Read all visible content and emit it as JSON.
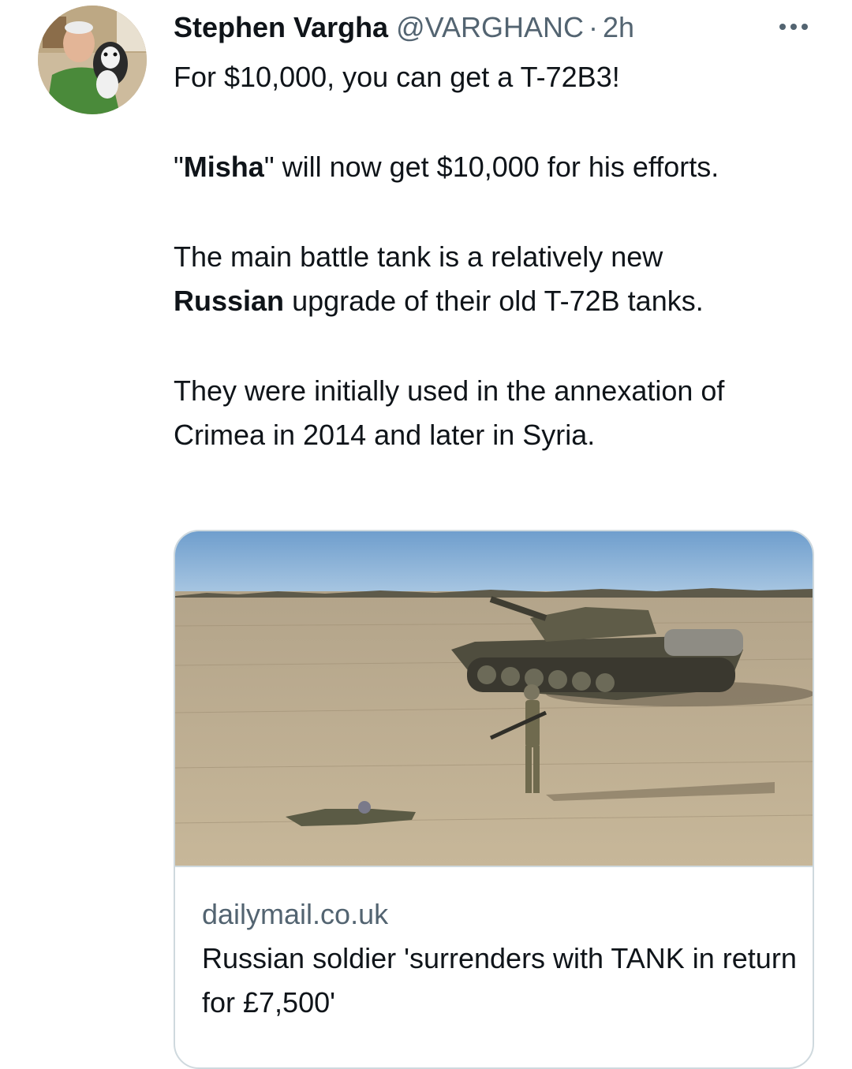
{
  "tweet": {
    "author_name": "Stephen Vargha",
    "author_handle": "@VARGHANC",
    "separator": "·",
    "time": "2h",
    "more_icon": "more-horizontal-icon",
    "avatar_icon": "profile-avatar",
    "text": {
      "line1": "For $10,000, you can get a T-72B3!",
      "p2_quote_open": "\"",
      "p2_bold": "Misha",
      "p2_rest": "\" will now get $10,000 for his efforts.",
      "p3_bold": "Russian",
      "p3_prefix": "The main battle tank is a relatively new",
      "p3_rest": "upgrade of their old T-72B tanks.",
      "p4": "They were initially used in the annexation of Crimea in 2014 and later in Syria."
    }
  },
  "link_card": {
    "domain": "dailymail.co.uk",
    "title": "Russian soldier 'surrenders with TANK in return for £7,500'"
  },
  "colors": {
    "text_primary": "#0f1419",
    "text_secondary": "#536471",
    "border": "#cfd9de",
    "background": "#ffffff"
  }
}
